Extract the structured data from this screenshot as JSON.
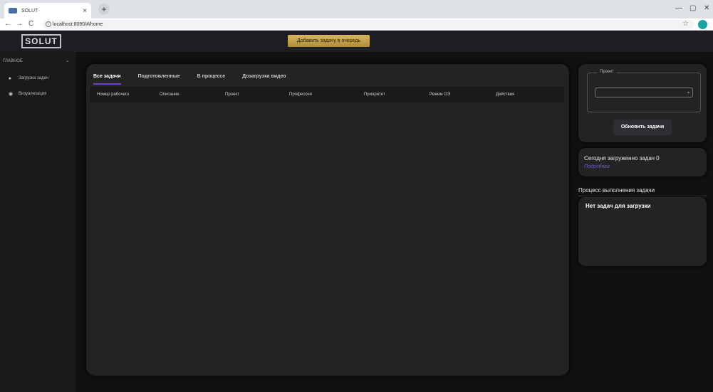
{
  "browser": {
    "tab_title": "SOLUT",
    "tab_close": "×",
    "new_tab": "+",
    "url": "localhost:8080/#/home",
    "back": "←",
    "forward": "→",
    "reload": "C",
    "minimize": "—",
    "restore": "▢",
    "close": "✕"
  },
  "header": {
    "logo": "SOLUT",
    "queue_button": "Добавить задачу в очередь"
  },
  "sidebar": {
    "section": "ГЛАВНОЕ",
    "items": [
      {
        "icon": "home-icon",
        "glyph": "♠",
        "label": "Загрузка задач"
      },
      {
        "icon": "eye-icon",
        "glyph": "◉",
        "label": "Визуализация"
      }
    ]
  },
  "main": {
    "tabs": [
      "Все задачи",
      "Подготовленные",
      "В процессе",
      "Дозагрузка видео"
    ],
    "active_tab": 0,
    "columns": [
      "Номер рабочего",
      "Описание",
      "Проект",
      "Профессия",
      "Приоритет",
      "Режим ОЭ",
      "Действия"
    ]
  },
  "right": {
    "project_legend": "Проект",
    "project_value": "",
    "refresh_button": "Обновить задачи",
    "today_text": "Сегодня загруженно задач 0",
    "more_link": "Подробнее",
    "process_title": "Процесс выполнения задачи",
    "no_tasks": "Нет задач для загрузки"
  },
  "colors": {
    "accent": "#6b3fd4",
    "queue_button": "#c9a64e",
    "panel": "#232326",
    "background": "#111113"
  }
}
